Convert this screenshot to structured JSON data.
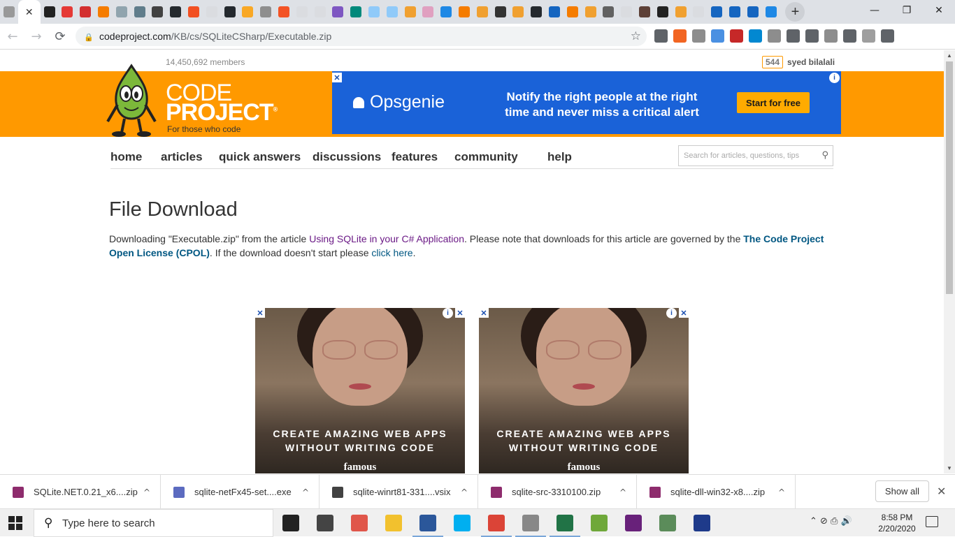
{
  "window": {
    "active_tab_close": "✕",
    "new_tab": "+",
    "minimize": "—",
    "restore": "❐",
    "close": "✕"
  },
  "tab_favicons": [
    "#999999",
    "#222222",
    "#e53935",
    "#d32f2f",
    "#f57c00",
    "#90a4ae",
    "#607d8b",
    "#424242",
    "#24292e",
    "#f25022",
    "#dadce0",
    "#24292e",
    "#f9a825",
    "#8e8e8e",
    "#f35325",
    "#dadce0",
    "#dadce0",
    "#7e57c2",
    "#00897b",
    "#90caf9",
    "#90caf9",
    "#f0a030",
    "#e0a0c0",
    "#1e88e5",
    "#f57c00",
    "#f0a030",
    "#333333",
    "#f0a030",
    "#24292e",
    "#1565c0",
    "#f57c00",
    "#f0a030",
    "#616161",
    "#dadce0",
    "#5d4037",
    "#222222",
    "#f0a030",
    "#dadce0",
    "#1565c0",
    "#1565c0",
    "#1565c0",
    "#1e88e5"
  ],
  "toolbar": {
    "back": "←",
    "forward": "→",
    "reload": "⟳",
    "url_host": "codeproject.com",
    "url_path": "/KB/cs/SQLiteCSharp/Executable.zip",
    "star": "☆",
    "lock": "🔒"
  },
  "extensions": [
    "#5f6368",
    "#f26522",
    "#8d8d8d",
    "#4a90e2",
    "#c62828",
    "#0288d1",
    "#8d8d8d",
    "#5f6368",
    "#5f6368",
    "#8d8d8d",
    "#5f6368",
    "#9e9e9e",
    "#5f6368"
  ],
  "header": {
    "members": "14,450,692 members",
    "reputation": "544",
    "username": "syed bilalali"
  },
  "logo": {
    "code": "CODE",
    "project": "PROJECT",
    "registered": "®",
    "tagline": "For those who code"
  },
  "ad_top": {
    "close": "✕",
    "info": "i",
    "brand": "Opsgenie",
    "message": "Notify the right people at the right time and never miss a critical alert",
    "cta": "Start for free"
  },
  "nav": {
    "items": [
      "home",
      "articles",
      "quick answers",
      "discussions",
      "features",
      "community",
      "help"
    ],
    "search_placeholder": "Search for articles, questions, tips",
    "search_icon": "⚲"
  },
  "content": {
    "title": "File Download",
    "text_1": "Downloading \"Executable.zip\" from the article ",
    "article_link": "Using SQLite in your C# Application",
    "text_2": ". Please note that downloads for this article are governed by the ",
    "license_link": "The Code Project Open License (CPOL)",
    "text_3": ". If the download doesn't start please ",
    "click_here": "click here",
    "text_4": "."
  },
  "bottom_ads": [
    {
      "close": "✕",
      "info": "i",
      "headline": "CREATE AMAZING WEB APPS WITHOUT WRITING CODE",
      "brand": "famous"
    },
    {
      "close": "✕",
      "info": "i",
      "headline": "CREATE AMAZING WEB APPS WITHOUT WRITING CODE",
      "brand": "famous"
    }
  ],
  "downloads": {
    "items": [
      {
        "name": "SQLite.NET.0.21_x6....zip",
        "icon_color": "#8e2c6d"
      },
      {
        "name": "sqlite-netFx45-set....exe",
        "icon_color": "#5c6bc0"
      },
      {
        "name": "sqlite-winrt81-331....vsix",
        "icon_color": "#424242"
      },
      {
        "name": "sqlite-src-3310100.zip",
        "icon_color": "#8e2c6d"
      },
      {
        "name": "sqlite-dll-win32-x8....zip",
        "icon_color": "#8e2c6d"
      }
    ],
    "caret": "^",
    "show_all": "Show all",
    "close": "✕"
  },
  "taskbar": {
    "search_placeholder": "Type here to search",
    "search_icon": "⚲",
    "apps": [
      "#222222",
      "#444444",
      "#e0564a",
      "#f2c12e",
      "#2b579a",
      "#00aff0",
      "#db4437",
      "#888888",
      "#217346",
      "#6fa83a",
      "#68217a",
      "#5b8c5a",
      "#1e3a8a"
    ],
    "time": "8:58 PM",
    "date": "2/20/2020",
    "tray_icons": "⌃  ⊘  ⎙  🔊"
  }
}
